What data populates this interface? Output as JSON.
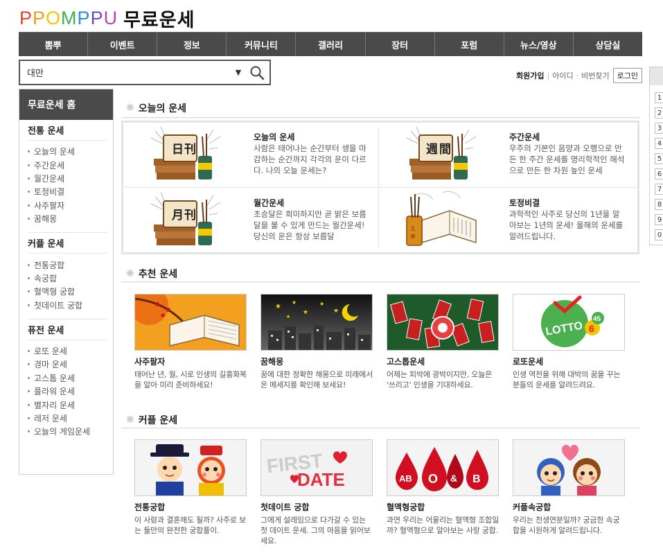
{
  "header": {
    "brand_letters": [
      "P",
      "P",
      "O",
      "M",
      "P",
      "P",
      "U"
    ],
    "brand_colors": [
      "#e8402b",
      "#f29b1d",
      "#f5c400",
      "#3db04a",
      "#2e8bd6",
      "#6a4bc4",
      "#c43fa8"
    ],
    "title": "무료운세"
  },
  "nav": {
    "items": [
      "뽐뿌",
      "이벤트",
      "정보",
      "커뮤니티",
      "갤러리",
      "장터",
      "포럼",
      "뉴스/영상",
      "상담실"
    ]
  },
  "search": {
    "value": "대만"
  },
  "member": {
    "join": "회원가입",
    "id": "아이디",
    "find_pw": "비번찾기",
    "login": "로그인"
  },
  "right_strip": {
    "numbers": [
      "1",
      "2",
      "3",
      "4",
      "5",
      "6",
      "7",
      "8",
      "9",
      "0"
    ]
  },
  "sidebar": {
    "home": "무료운세 홈",
    "groups": [
      {
        "title": "전통 운세",
        "items": [
          "오늘의 운세",
          "주간운세",
          "월간운세",
          "토정비결",
          "사주팔자",
          "꿈해몽"
        ]
      },
      {
        "title": "커플 운세",
        "items": [
          "전통궁합",
          "속궁합",
          "혈액형 궁합",
          "첫데이트 궁합"
        ]
      },
      {
        "title": "퓨전 운세",
        "items": [
          "로또 운세",
          "경마 운세",
          "고스톱 운세",
          "플라워 운세",
          "별자리 운세",
          "레저 운세",
          "오늘의 게임운세"
        ]
      }
    ]
  },
  "today": {
    "section_title": "오늘의 운세",
    "items": [
      {
        "title": "오늘의 운세",
        "desc": "사람은 태어나는 순간부터 생을 마감하는 순간까지 각각의 운이 다르다. 나의 오늘 운세는?",
        "chars": [
          "日",
          "刊"
        ]
      },
      {
        "title": "주간운세",
        "desc": "우주의 기본인 음양과 오행으로 만든 한 주간 운세를 명리학적인 해석으로 만든 한 차원 높인 운세",
        "chars": [
          "週",
          "間"
        ]
      },
      {
        "title": "월간운세",
        "desc": "초승달은 희미하지만 곧 밝은 보름달을 볼 수 있게 만드는 월간운세! 당신의 운은 항상 보름달",
        "chars": [
          "月",
          "刊"
        ]
      },
      {
        "title": "토정비결",
        "desc": "과학적인 사주로 당신의 1년을 알아보는 1년의 운세! 올해의 운세를 알려드립니다.",
        "chars": [
          "土",
          "亭"
        ]
      }
    ]
  },
  "recommend": {
    "section_title": "추천 운세",
    "cards": [
      {
        "title": "사주팔자",
        "desc": "태어난 년, 월, 시로 인생의 길흉화복을 알아 미리 준비하세요!"
      },
      {
        "title": "꿈해몽",
        "desc": "꿈에 대한 정확한 해몽으로 미래에서 온 메세지를 확인해 보세요!"
      },
      {
        "title": "고스톱운세",
        "desc": "어제는 피박에 광박이지만, 오늘은 '쓰리고' 인생을 기대하세요."
      },
      {
        "title": "로또운세",
        "desc": "인생 역전을 위해 대박의 꿈을 꾸는 분들의 운세를 알려드려요.",
        "lotto_text": "LOTTO",
        "lotto_num": "6",
        "lotto_sub": "45"
      }
    ]
  },
  "couple": {
    "section_title": "커플 운세",
    "cards": [
      {
        "title": "전통궁합",
        "desc": "이 사람과 결혼해도 될까? 사주로 보는 둘만의 완전한 궁합풀이."
      },
      {
        "title": "첫데이트 궁합",
        "desc": "그에게 설레임으로 다가갈 수 있는 첫 데이트 운세. 그의 마음을 읽어보세요.",
        "img_line1": "FIRST",
        "img_line2": "DATE"
      },
      {
        "title": "혈액형궁합",
        "desc": "과연 우리는 어울리는 혈액형 조합일까? 혈액형으로 알아보는 사랑 궁합.",
        "blood": [
          "AB",
          "O",
          "&",
          "B"
        ]
      },
      {
        "title": "커플속궁합",
        "desc": "우리는 천생연분일까? 궁금한 속궁합을 시원하게 알려드립니다."
      }
    ]
  }
}
